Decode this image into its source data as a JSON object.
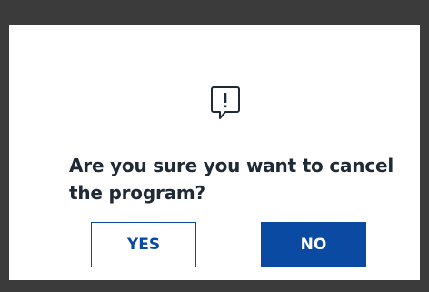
{
  "dialog": {
    "message": "Are you sure you want to cancel the program?",
    "icon": "alert-speech-bubble-icon"
  },
  "buttons": {
    "yes_label": "YES",
    "no_label": "NO"
  },
  "colors": {
    "primary": "#0a4aa3",
    "text": "#1f2a37",
    "backdrop": "#3b3b3b",
    "dialog_bg": "#ffffff"
  }
}
